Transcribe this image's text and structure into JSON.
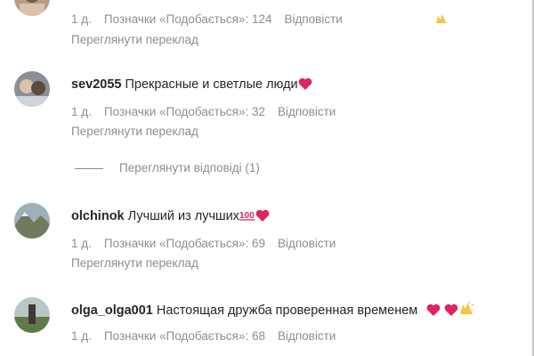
{
  "comments": [
    {
      "username": "",
      "text": "",
      "time": "1 д.",
      "likes": "Позначки «Подобається»: 124",
      "reply": "Відповісти",
      "translate": "Переглянути переклад"
    },
    {
      "username": "sev2055",
      "text": "Прекрасные и светлые люди",
      "time": "1 д.",
      "likes": "Позначки «Подобається»: 32",
      "reply": "Відповісти",
      "translate": "Переглянути переклад"
    },
    {
      "username": "olchinok",
      "text": "Лучший из лучших",
      "time": "1 д.",
      "likes": "Позначки «Подобається»: 69",
      "reply": "Відповісти",
      "translate": "Переглянути переклад"
    },
    {
      "username": "olga_olga001",
      "text": "Настоящая дружба проверенная временем",
      "time": "1 д.",
      "likes": "Позначки «Подобається»: 68",
      "reply": "Відповісти"
    }
  ],
  "view_replies": "Переглянути відповіді (1)",
  "colors": {
    "heart": "#e0245e",
    "meta": "#8e8e8e",
    "text": "#262626"
  },
  "icons": [
    "heart-emoji",
    "hundred-points-emoji",
    "clapping-hands-emoji"
  ]
}
